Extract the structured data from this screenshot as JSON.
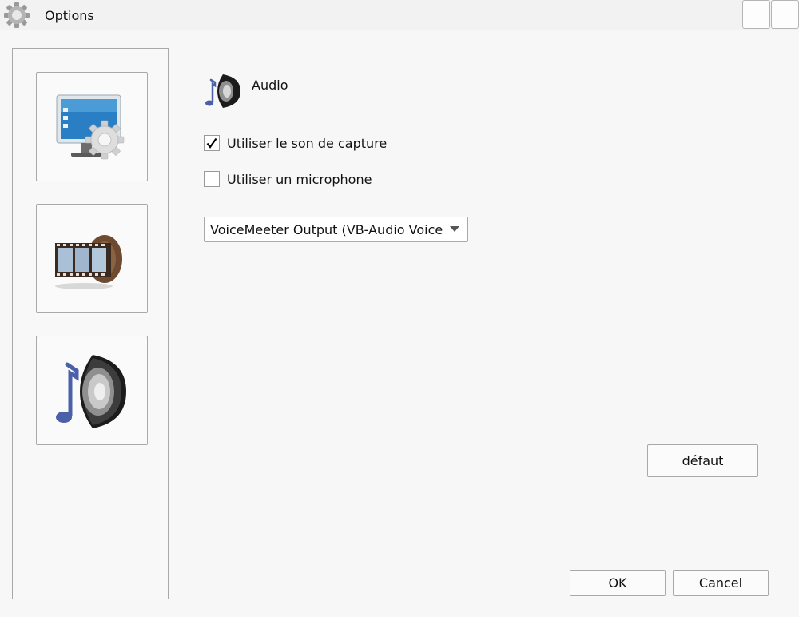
{
  "window": {
    "title": "Options",
    "app_icon": "gear-icon"
  },
  "sidebar": {
    "items": [
      {
        "id": "general",
        "icon": "monitor-gear-icon",
        "selected": false
      },
      {
        "id": "video",
        "icon": "film-strip-icon",
        "selected": false
      },
      {
        "id": "audio",
        "icon": "speaker-note-icon",
        "selected": true
      }
    ]
  },
  "main": {
    "section_title": "Audio",
    "section_icon": "speaker-note-icon",
    "options": [
      {
        "label": "Utiliser le son de capture",
        "checked": true
      },
      {
        "label": "Utiliser un microphone",
        "checked": false
      }
    ],
    "device_select": {
      "value": "VoiceMeeter Output (VB-Audio VoiceMeeter VAIO)"
    },
    "default_button": "défaut"
  },
  "footer": {
    "ok_label": "OK",
    "cancel_label": "Cancel"
  },
  "colors": {
    "border": "#a9a9a9",
    "background": "#f7f7f7",
    "titlebar": "#f2f2f2"
  }
}
